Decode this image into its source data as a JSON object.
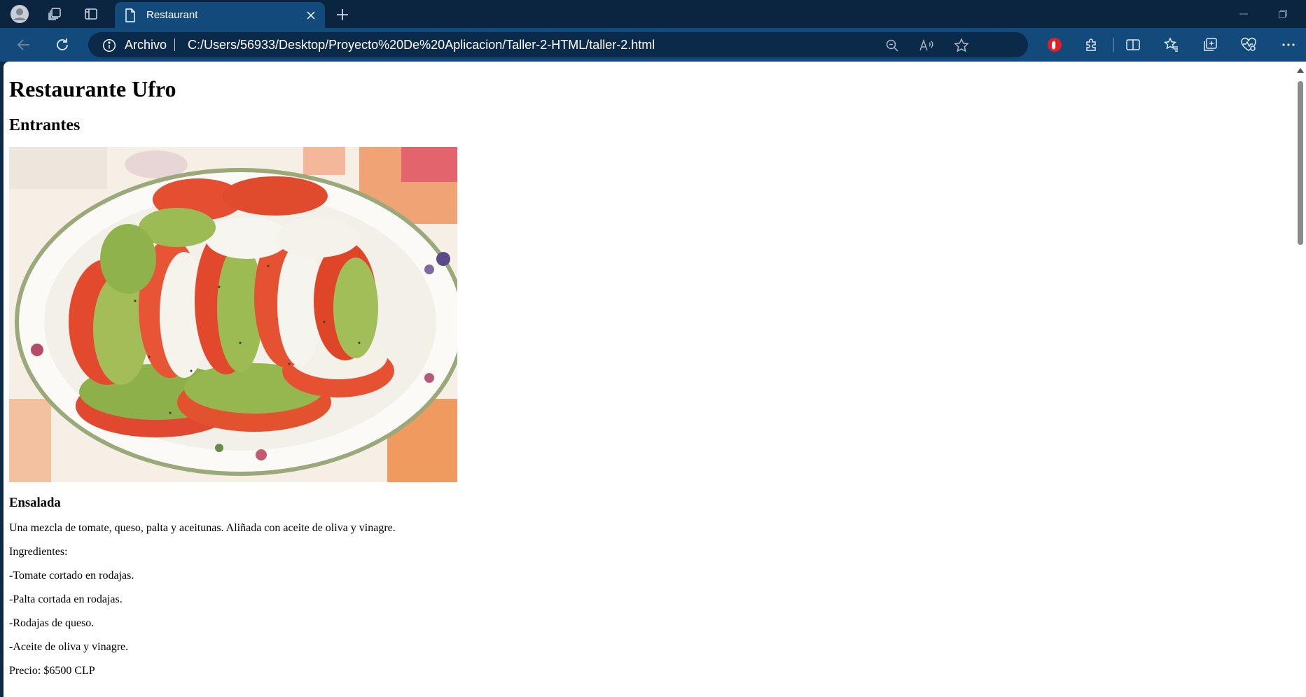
{
  "browser": {
    "tab_title": "Restaurant",
    "address_prefix": "Archivo",
    "url": "C:/Users/56933/Desktop/Proyecto%20De%20Aplicacion/Taller-2-HTML/taller-2.html"
  },
  "page": {
    "title": "Restaurante Ufro",
    "section": "Entrantes",
    "dish": {
      "name": "Ensalada",
      "description": "Una mezcla de tomate, queso, palta y aceitunas. Aliñada con aceite de oliva y vinagre.",
      "ingredients_label": "Ingredientes:",
      "ingredients": [
        "-Tomate cortado en rodajas.",
        "-Palta cortada en rodajas.",
        "-Rodajas de queso.",
        "-Aceite de oliva y vinagre."
      ],
      "price": "Precio: $6500 CLP"
    }
  },
  "icons": {
    "profile": "profile-icon",
    "workspaces": "workspaces-icon",
    "vertical_tabs": "vertical-tabs-icon",
    "zoom": "zoom-out-icon",
    "read_aloud": "read-aloud-icon",
    "favorite": "star-icon",
    "extension_red": "adblock-icon",
    "extensions": "puzzle-icon",
    "split": "split-screen-icon",
    "favorites": "favorites-icon",
    "collections": "collections-icon",
    "performance": "heart-pulse-icon",
    "more": "more-icon"
  },
  "colors": {
    "tabbar": "#0b2540",
    "toolbar": "#134a7c",
    "omnibox": "#0b2a4a",
    "page_bg": "#ffffff"
  }
}
